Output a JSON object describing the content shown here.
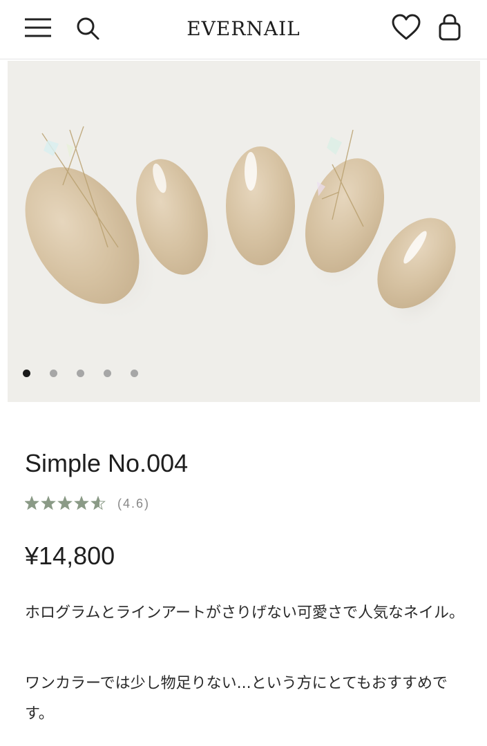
{
  "header": {
    "logo": "EVERNAIL",
    "icons": [
      "menu-icon",
      "search-icon",
      "heart-icon",
      "shopping-bag-icon"
    ]
  },
  "gallery": {
    "slide_count": 5,
    "active_index": 0
  },
  "product": {
    "title": "Simple No.004",
    "rating_value": 4.6,
    "rating_text": "(4.6)",
    "star_color": "#8a9a86",
    "price": "¥14,800",
    "description_1": "ホログラムとラインアートがさりげない可愛さで人気なネイル。",
    "description_2": "ワンカラーでは少し物足りない...という方にとてもおすすめです。"
  }
}
